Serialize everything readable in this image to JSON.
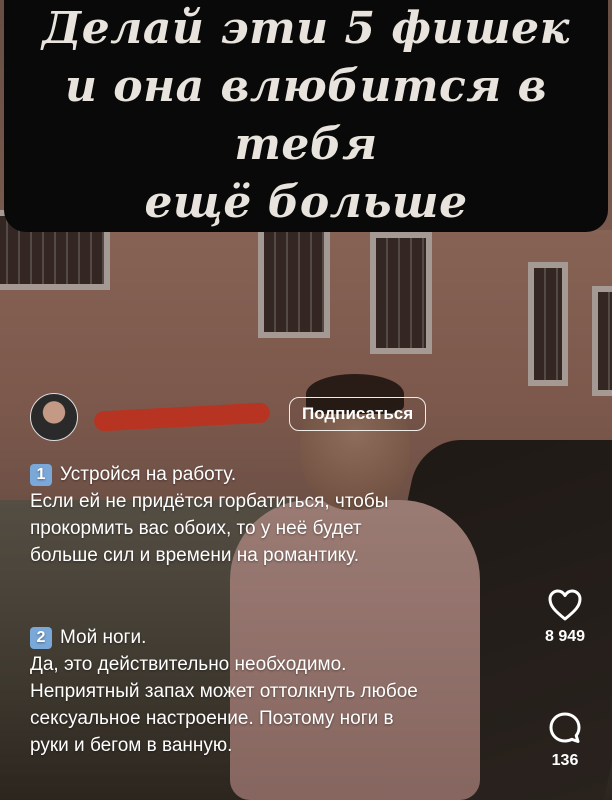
{
  "title": {
    "lines": [
      "Делай эти 5 фишек",
      "и она влюбится в тебя",
      "ещё больше"
    ]
  },
  "post": {
    "subscribe_label": "Подписаться",
    "tips": [
      {
        "number": "1",
        "heading": "Устройся на работу.",
        "body": [
          "Если ей не придётся горбатиться, чтобы",
          "прокормить вас обоих, то у неё будет",
          "больше сил и времени на романтику."
        ]
      },
      {
        "number": "2",
        "heading": "Мой ноги.",
        "body": [
          "Да, это действительно необходимо.",
          "Неприятный запах может оттолкнуть любое",
          "сексуальное настроение. Поэтому ноги в",
          "руки и бегом в ванную."
        ]
      }
    ],
    "likes_count": "8 949",
    "comments_count": "136",
    "icons": {
      "like": "heart-icon",
      "comment": "comment-icon"
    }
  },
  "colors": {
    "accent_badge": "#7aa8d8",
    "redaction": "#b83422"
  }
}
